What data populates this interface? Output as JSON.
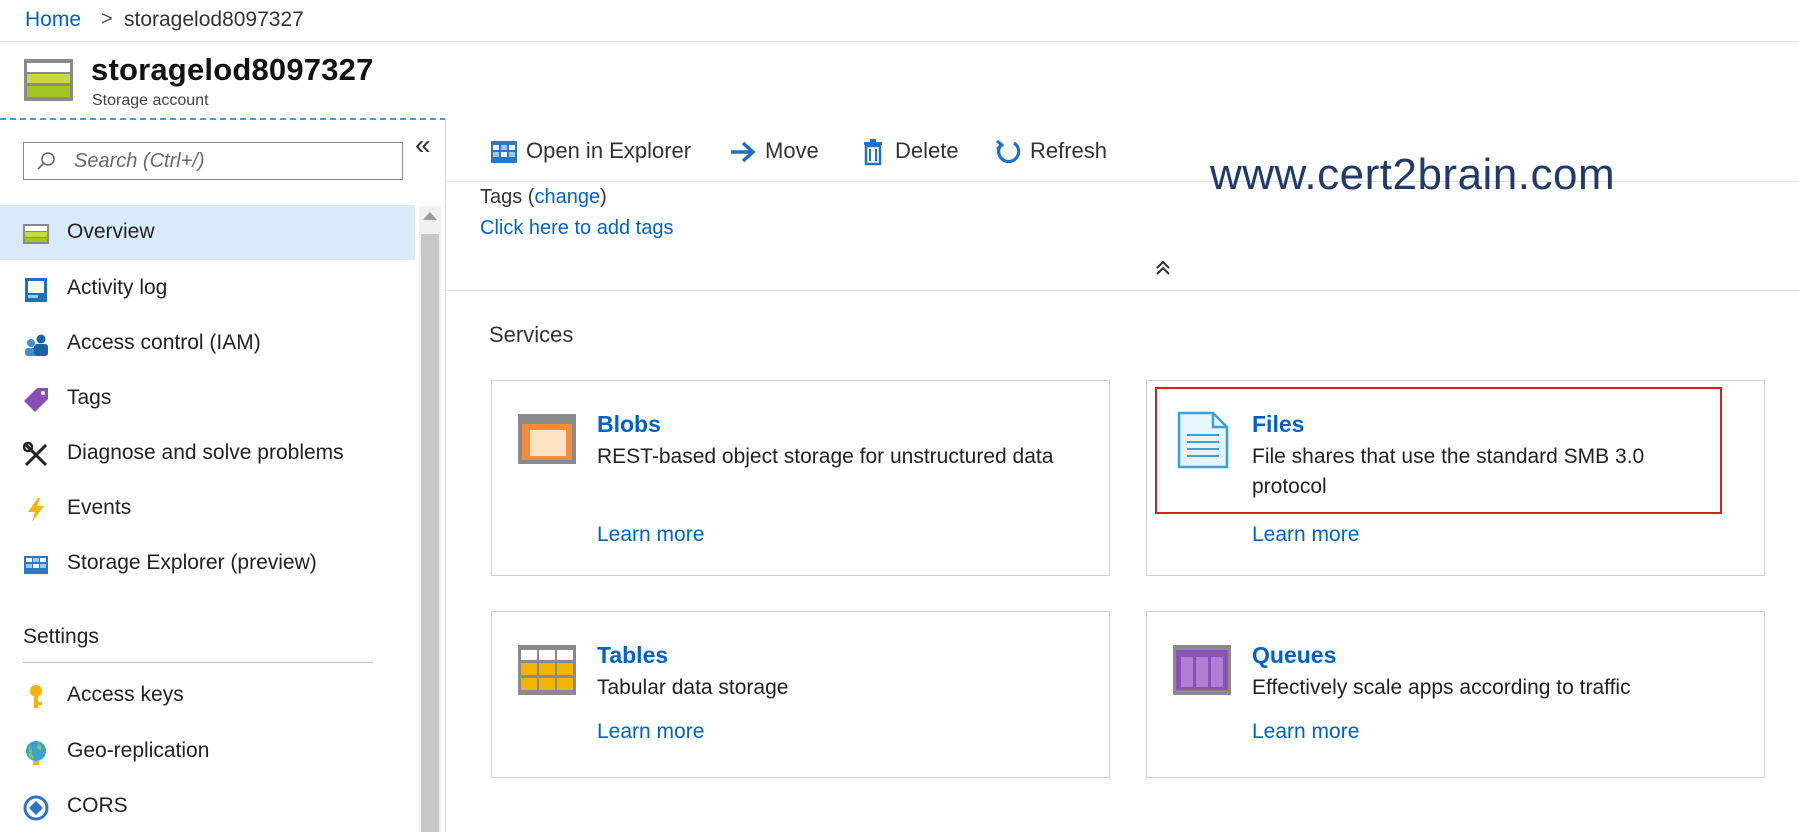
{
  "breadcrumb": {
    "home": "Home",
    "separator": ">",
    "current": "storagelod8097327"
  },
  "resource": {
    "name": "storagelod8097327",
    "type": "Storage account"
  },
  "sidebar": {
    "search_placeholder": "Search (Ctrl+/)",
    "collapse_label": "«",
    "items": [
      {
        "label": "Overview",
        "icon": "storage-overview-icon",
        "selected": true
      },
      {
        "label": "Activity log",
        "icon": "activity-log-icon"
      },
      {
        "label": "Access control (IAM)",
        "icon": "iam-icon"
      },
      {
        "label": "Tags",
        "icon": "tag-icon"
      },
      {
        "label": "Diagnose and solve problems",
        "icon": "wrench-icon"
      },
      {
        "label": "Events",
        "icon": "lightning-icon"
      },
      {
        "label": "Storage Explorer (preview)",
        "icon": "storage-explorer-icon"
      }
    ],
    "settings_header": "Settings",
    "settings_items": [
      {
        "label": "Access keys",
        "icon": "key-icon"
      },
      {
        "label": "Geo-replication",
        "icon": "globe-icon"
      },
      {
        "label": "CORS",
        "icon": "cors-icon"
      }
    ]
  },
  "toolbar": {
    "open_explorer": "Open in Explorer",
    "move": "Move",
    "delete": "Delete",
    "refresh": "Refresh"
  },
  "watermark": "www.cert2brain.com",
  "tags": {
    "label": "Tags",
    "change": "change",
    "add": "Click here to add tags"
  },
  "services": {
    "header": "Services",
    "cards": [
      {
        "title": "Blobs",
        "description": "REST-based object storage for unstructured data",
        "learn_more": "Learn more",
        "icon": "blob-icon"
      },
      {
        "title": "Files",
        "description": "File shares that use the standard SMB 3.0 protocol",
        "learn_more": "Learn more",
        "icon": "file-icon"
      },
      {
        "title": "Tables",
        "description": "Tabular data storage",
        "learn_more": "Learn more",
        "icon": "table-icon"
      },
      {
        "title": "Queues",
        "description": "Effectively scale apps according to traffic",
        "learn_more": "Learn more",
        "icon": "queue-icon"
      }
    ]
  },
  "colors": {
    "link": "#0062c9",
    "selected_bg": "#d9ebfa",
    "highlight_box": "#d42020"
  }
}
